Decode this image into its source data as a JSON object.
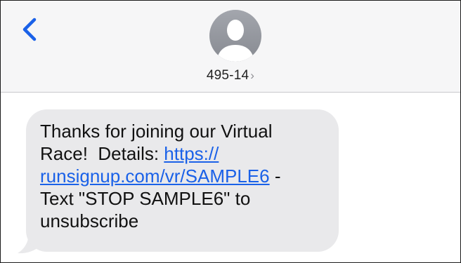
{
  "contact": {
    "name": "495-14",
    "chevron": "›"
  },
  "message": {
    "line1": "Thanks for joining our Virtual",
    "line2_text": "Race!  Details: ",
    "link_part1": "https://",
    "link_part2": "runsignup.com/vr/SAMPLE6",
    "line3_after": " -",
    "line4": "Text \"STOP SAMPLE6\" to",
    "line5": "unsubscribe"
  },
  "colors": {
    "accent": "#1a61e8",
    "bubble": "#e9e9eb",
    "header_bg": "#f6f6f7"
  },
  "icons": {
    "back": "chevron-left-icon",
    "avatar": "person-silhouette-icon"
  }
}
